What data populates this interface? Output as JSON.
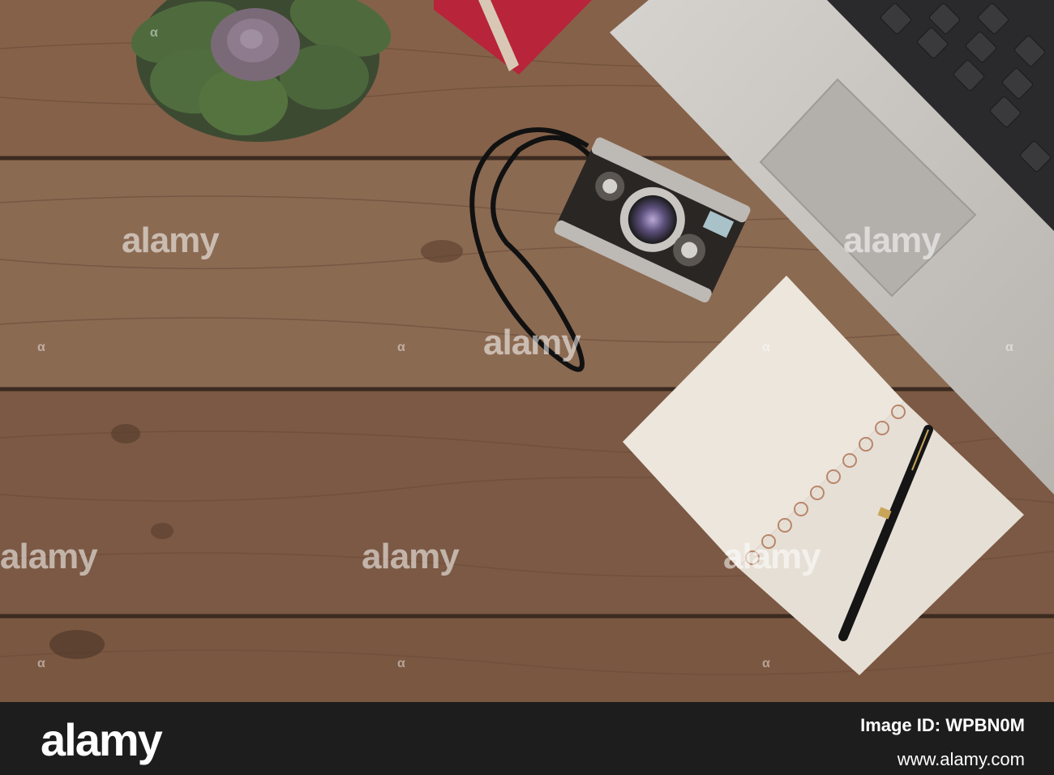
{
  "watermark": {
    "text": "alamy"
  },
  "footer": {
    "logo": "alamy",
    "image_id": "Image ID: WPBN0M",
    "url": "www.alamy.com"
  },
  "scene": {
    "objects": [
      "wooden-desk",
      "succulent-plant",
      "red-notebook",
      "vintage-camera",
      "laptop",
      "spiral-notepad",
      "fountain-pen"
    ],
    "colors": {
      "wood": "#7f5b45",
      "laptop": "#c9c6c2",
      "notebook_red": "#b8243a",
      "paper": "#ece6dd",
      "footer": "#1d1d1d"
    }
  }
}
